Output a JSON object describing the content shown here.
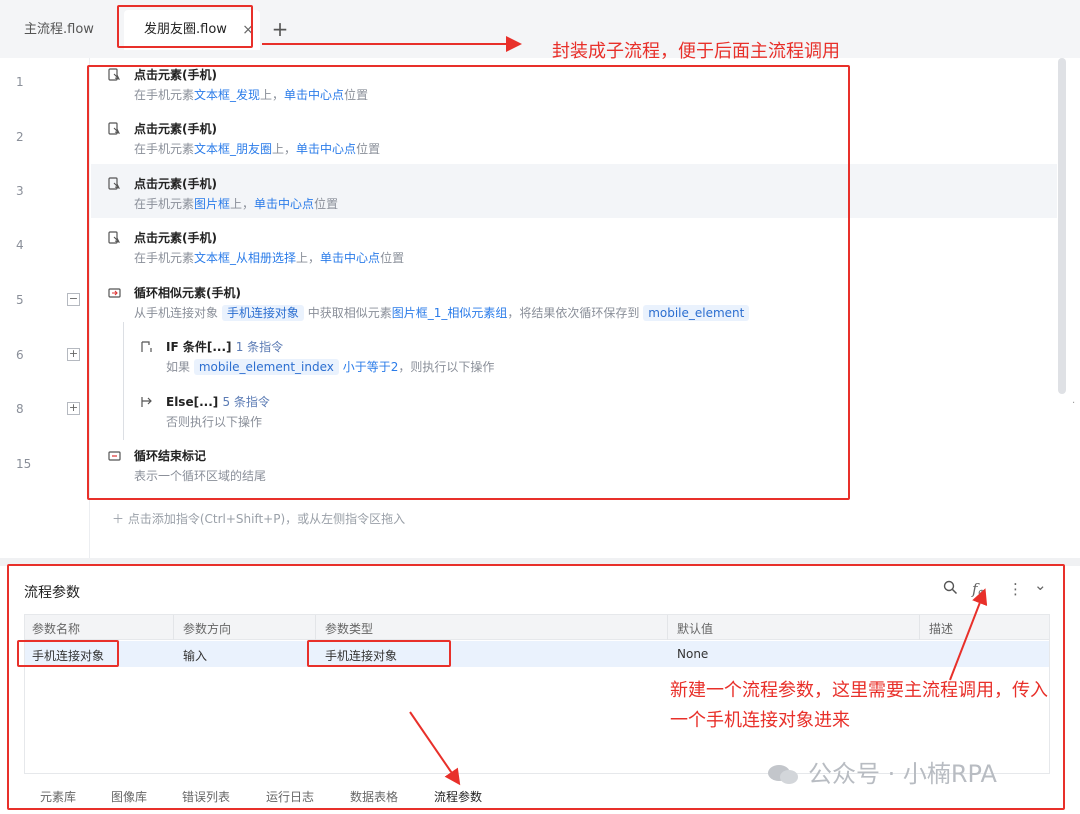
{
  "tabs": {
    "main_label": "主流程.flow",
    "active_label": "发朋友圈.flow",
    "close_glyph": "×",
    "add_glyph": "+"
  },
  "line_numbers": [
    "1",
    "2",
    "3",
    "4",
    "5",
    "6",
    "8",
    "15"
  ],
  "folds": {
    "expanded": "−",
    "collapsed": "+"
  },
  "commands": [
    {
      "icon": "tap-element-icon",
      "title": "点击元素(手机)",
      "d1": "在手机元素",
      "d2": "文本框_发现",
      "d3": "上，",
      "d4": "单击中心点",
      "d5": "位置"
    },
    {
      "icon": "tap-element-icon",
      "title": "点击元素(手机)",
      "d1": "在手机元素",
      "d2": "文本框_朋友圈",
      "d3": "上，",
      "d4": "单击中心点",
      "d5": "位置"
    },
    {
      "icon": "tap-element-icon",
      "title": "点击元素(手机)",
      "d1": "在手机元素",
      "d2": "图片框",
      "d3": "上，",
      "d4": "单击中心点",
      "d5": "位置"
    },
    {
      "icon": "tap-element-icon",
      "title": "点击元素(手机)",
      "d1": "在手机元素",
      "d2": "文本框_从相册选择",
      "d3": "上，",
      "d4": "单击中心点",
      "d5": "位置"
    }
  ],
  "loop_cmd": {
    "title": "循环相似元素(手机)",
    "d1": "从手机连接对象",
    "chip1": "手机连接对象",
    "d2": "中获取相似元素",
    "d3": "图片框_1_相似元素组",
    "d4": "，将结果依次循环保存到",
    "chip2": "mobile_element"
  },
  "if_cmd": {
    "title": "IF 条件[...]",
    "count": "1 条指令",
    "d1": "如果",
    "chip": "mobile_element_index",
    "d2": "小于等于2",
    "d3": "，则执行以下操作"
  },
  "else_cmd": {
    "title": "Else[...]",
    "count": "5 条指令",
    "desc": "否则执行以下操作"
  },
  "loop_end": {
    "title": "循环结束标记",
    "desc": "表示一个循环区域的结尾"
  },
  "add_command": "＋ 点击添加指令(Ctrl+Shift+P)，或从左侧指令区拖入",
  "panel": {
    "title": "流程参数",
    "headers": [
      "参数名称",
      "参数方向",
      "参数类型",
      "默认值",
      "描述"
    ],
    "rows": [
      {
        "name": "手机连接对象",
        "direction": "输入",
        "type": "手机连接对象",
        "default": "None",
        "desc": ""
      }
    ],
    "fx_label": "f",
    "more_glyph": "⋮",
    "collapse_glyph": "⌄"
  },
  "bottom_tabs": [
    "元素库",
    "图像库",
    "错误列表",
    "运行日志",
    "数据表格",
    "流程参数"
  ],
  "annotations": {
    "top": "封装成子流程，便于后面主流程调用",
    "bottom": "新建一个流程参数，这里需要主流程调用，传入一个手机连接对象进来"
  },
  "watermark": "公众号 · 小楠RPA",
  "colors": {
    "annotation": "#e8302a",
    "link": "#2b7ce9",
    "highlight": "#eaf2fd"
  }
}
